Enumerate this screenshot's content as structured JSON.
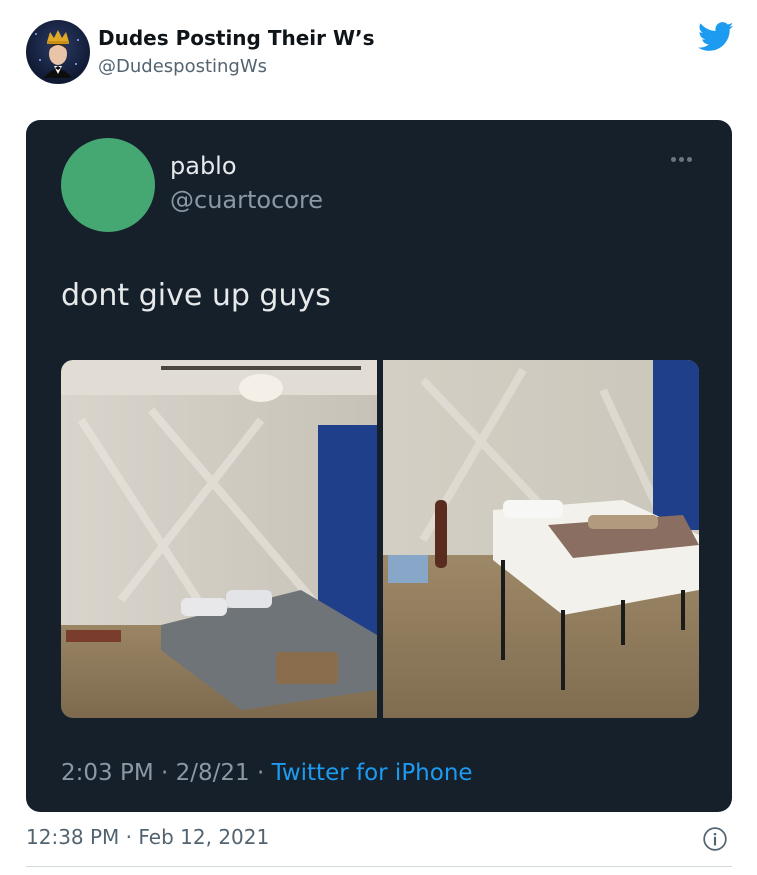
{
  "outer_tweet": {
    "display_name": "Dudes Posting Their W’s",
    "handle": "@DudespostingWs",
    "timestamp": "12:38 PM · Feb 12, 2021",
    "avatar_icon": "crowned-man-avatar",
    "brand_icon": "twitter-bird-icon",
    "info_icon": "info-icon"
  },
  "embedded_tweet": {
    "display_name": "pablo",
    "handle": "@cuartocore",
    "text": "dont give up guys",
    "avatar_color": "#45a772",
    "time": "2:03 PM",
    "separator": " · ",
    "date": "2/8/21",
    "source": "Twitter for iPhone",
    "menu_icon": "more-options-icon",
    "photos": [
      {
        "subject": "room with air mattress"
      },
      {
        "subject": "room with bed on metal frame"
      }
    ]
  },
  "colors": {
    "card_bg": "#15202b",
    "link_blue": "#1d9bf0",
    "twitter_blue": "#1d9bf0"
  }
}
